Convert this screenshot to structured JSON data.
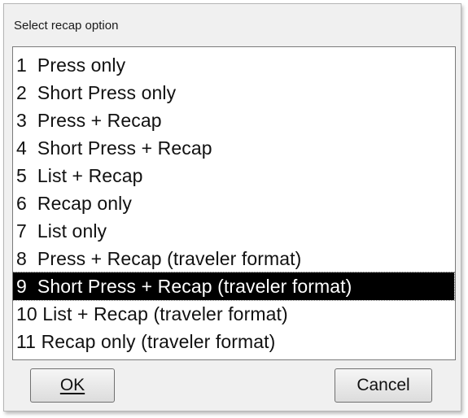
{
  "dialog": {
    "title": "Select recap option"
  },
  "options": {
    "selected_index": 8,
    "items": [
      {
        "label": "1  Press only"
      },
      {
        "label": "2  Short Press only"
      },
      {
        "label": "3  Press + Recap"
      },
      {
        "label": "4  Short Press + Recap"
      },
      {
        "label": "5  List + Recap"
      },
      {
        "label": "6  Recap only"
      },
      {
        "label": "7  List only"
      },
      {
        "label": "8  Press + Recap (traveler format)"
      },
      {
        "label": "9  Short Press + Recap (traveler format)"
      },
      {
        "label": "10 List + Recap (traveler format)"
      },
      {
        "label": "11 Recap only (traveler format)"
      }
    ]
  },
  "buttons": {
    "ok_label": "OK",
    "cancel_label": "Cancel"
  }
}
